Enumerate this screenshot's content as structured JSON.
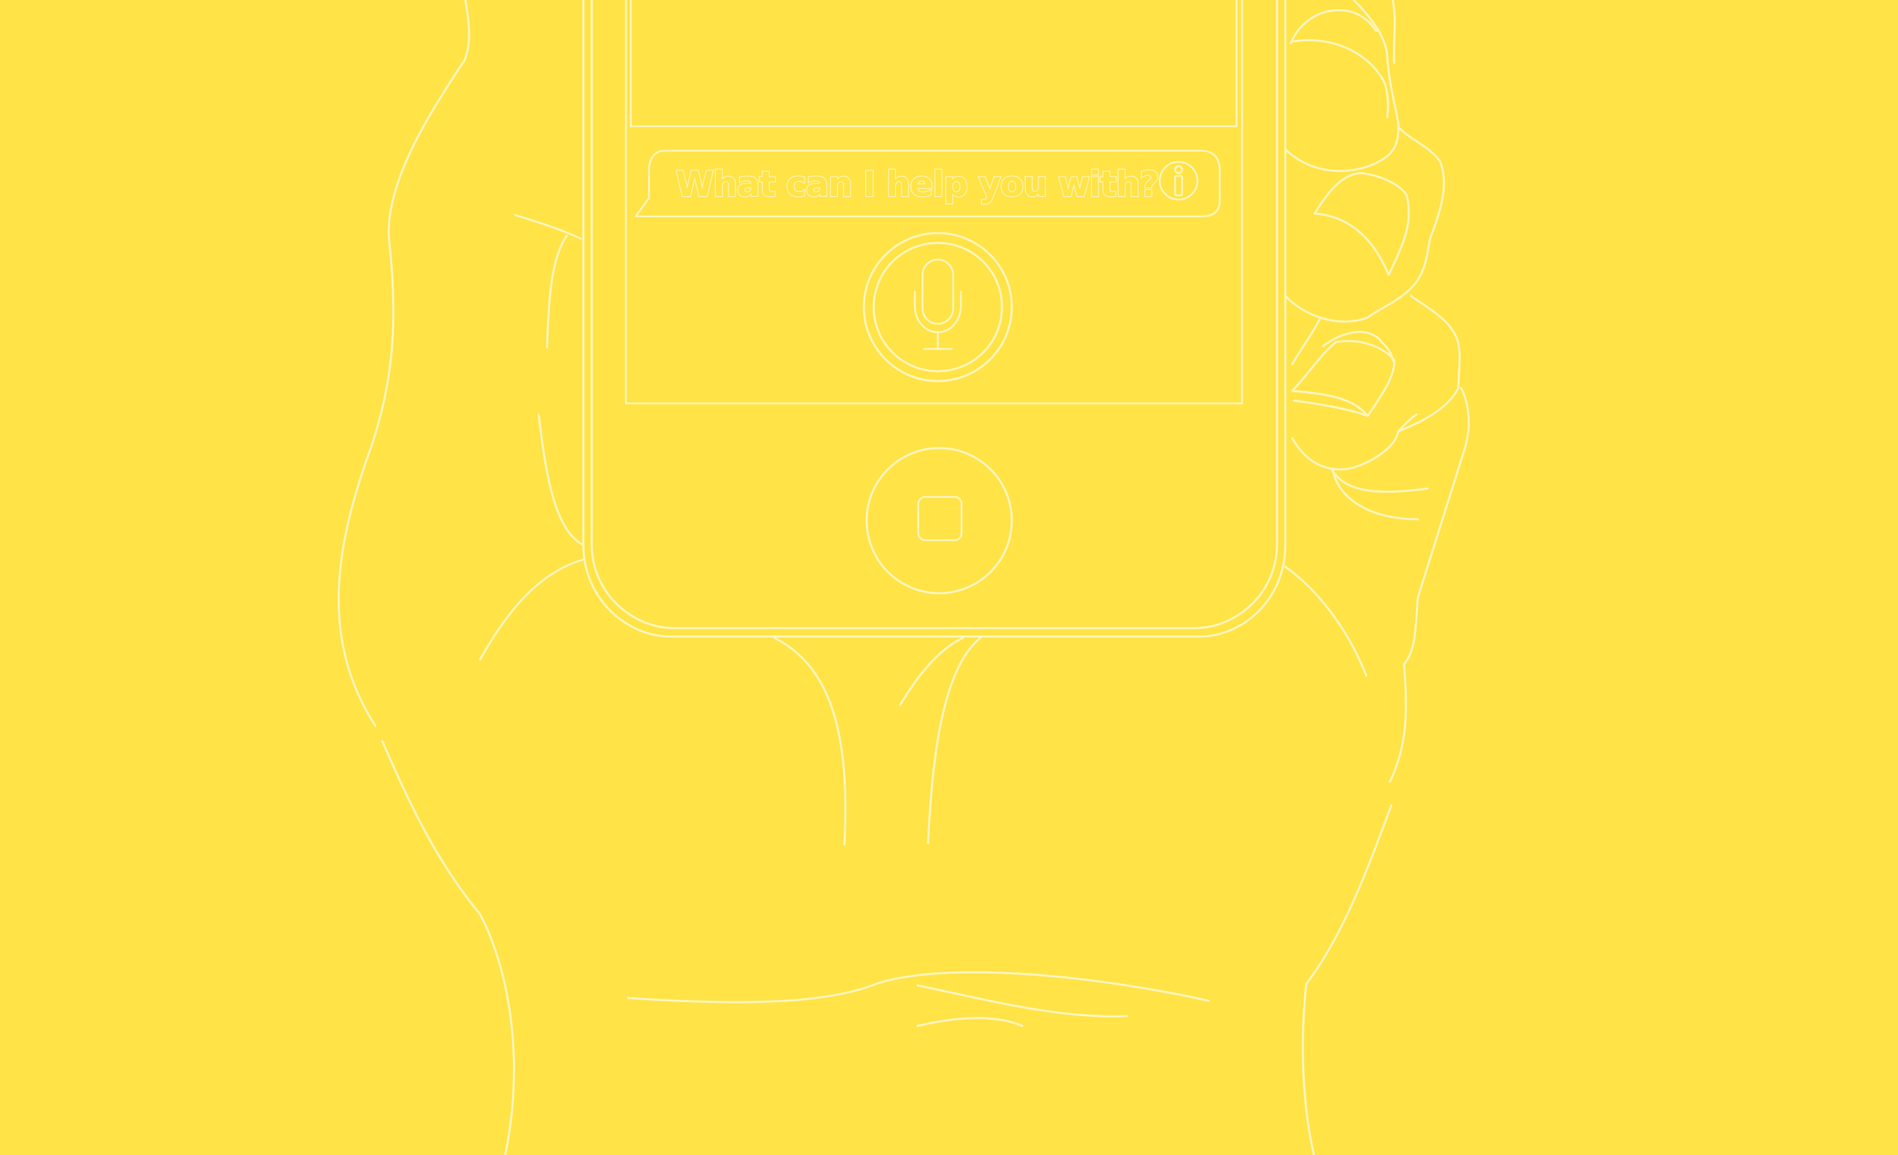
{
  "illustration": {
    "background_color": "#FFE347",
    "line_color": "#FFF6C0"
  },
  "assistant": {
    "prompt": "What can I help you with?",
    "info_icon": "info-icon",
    "mic_icon": "microphone-icon",
    "home_icon": "home-button-icon"
  }
}
